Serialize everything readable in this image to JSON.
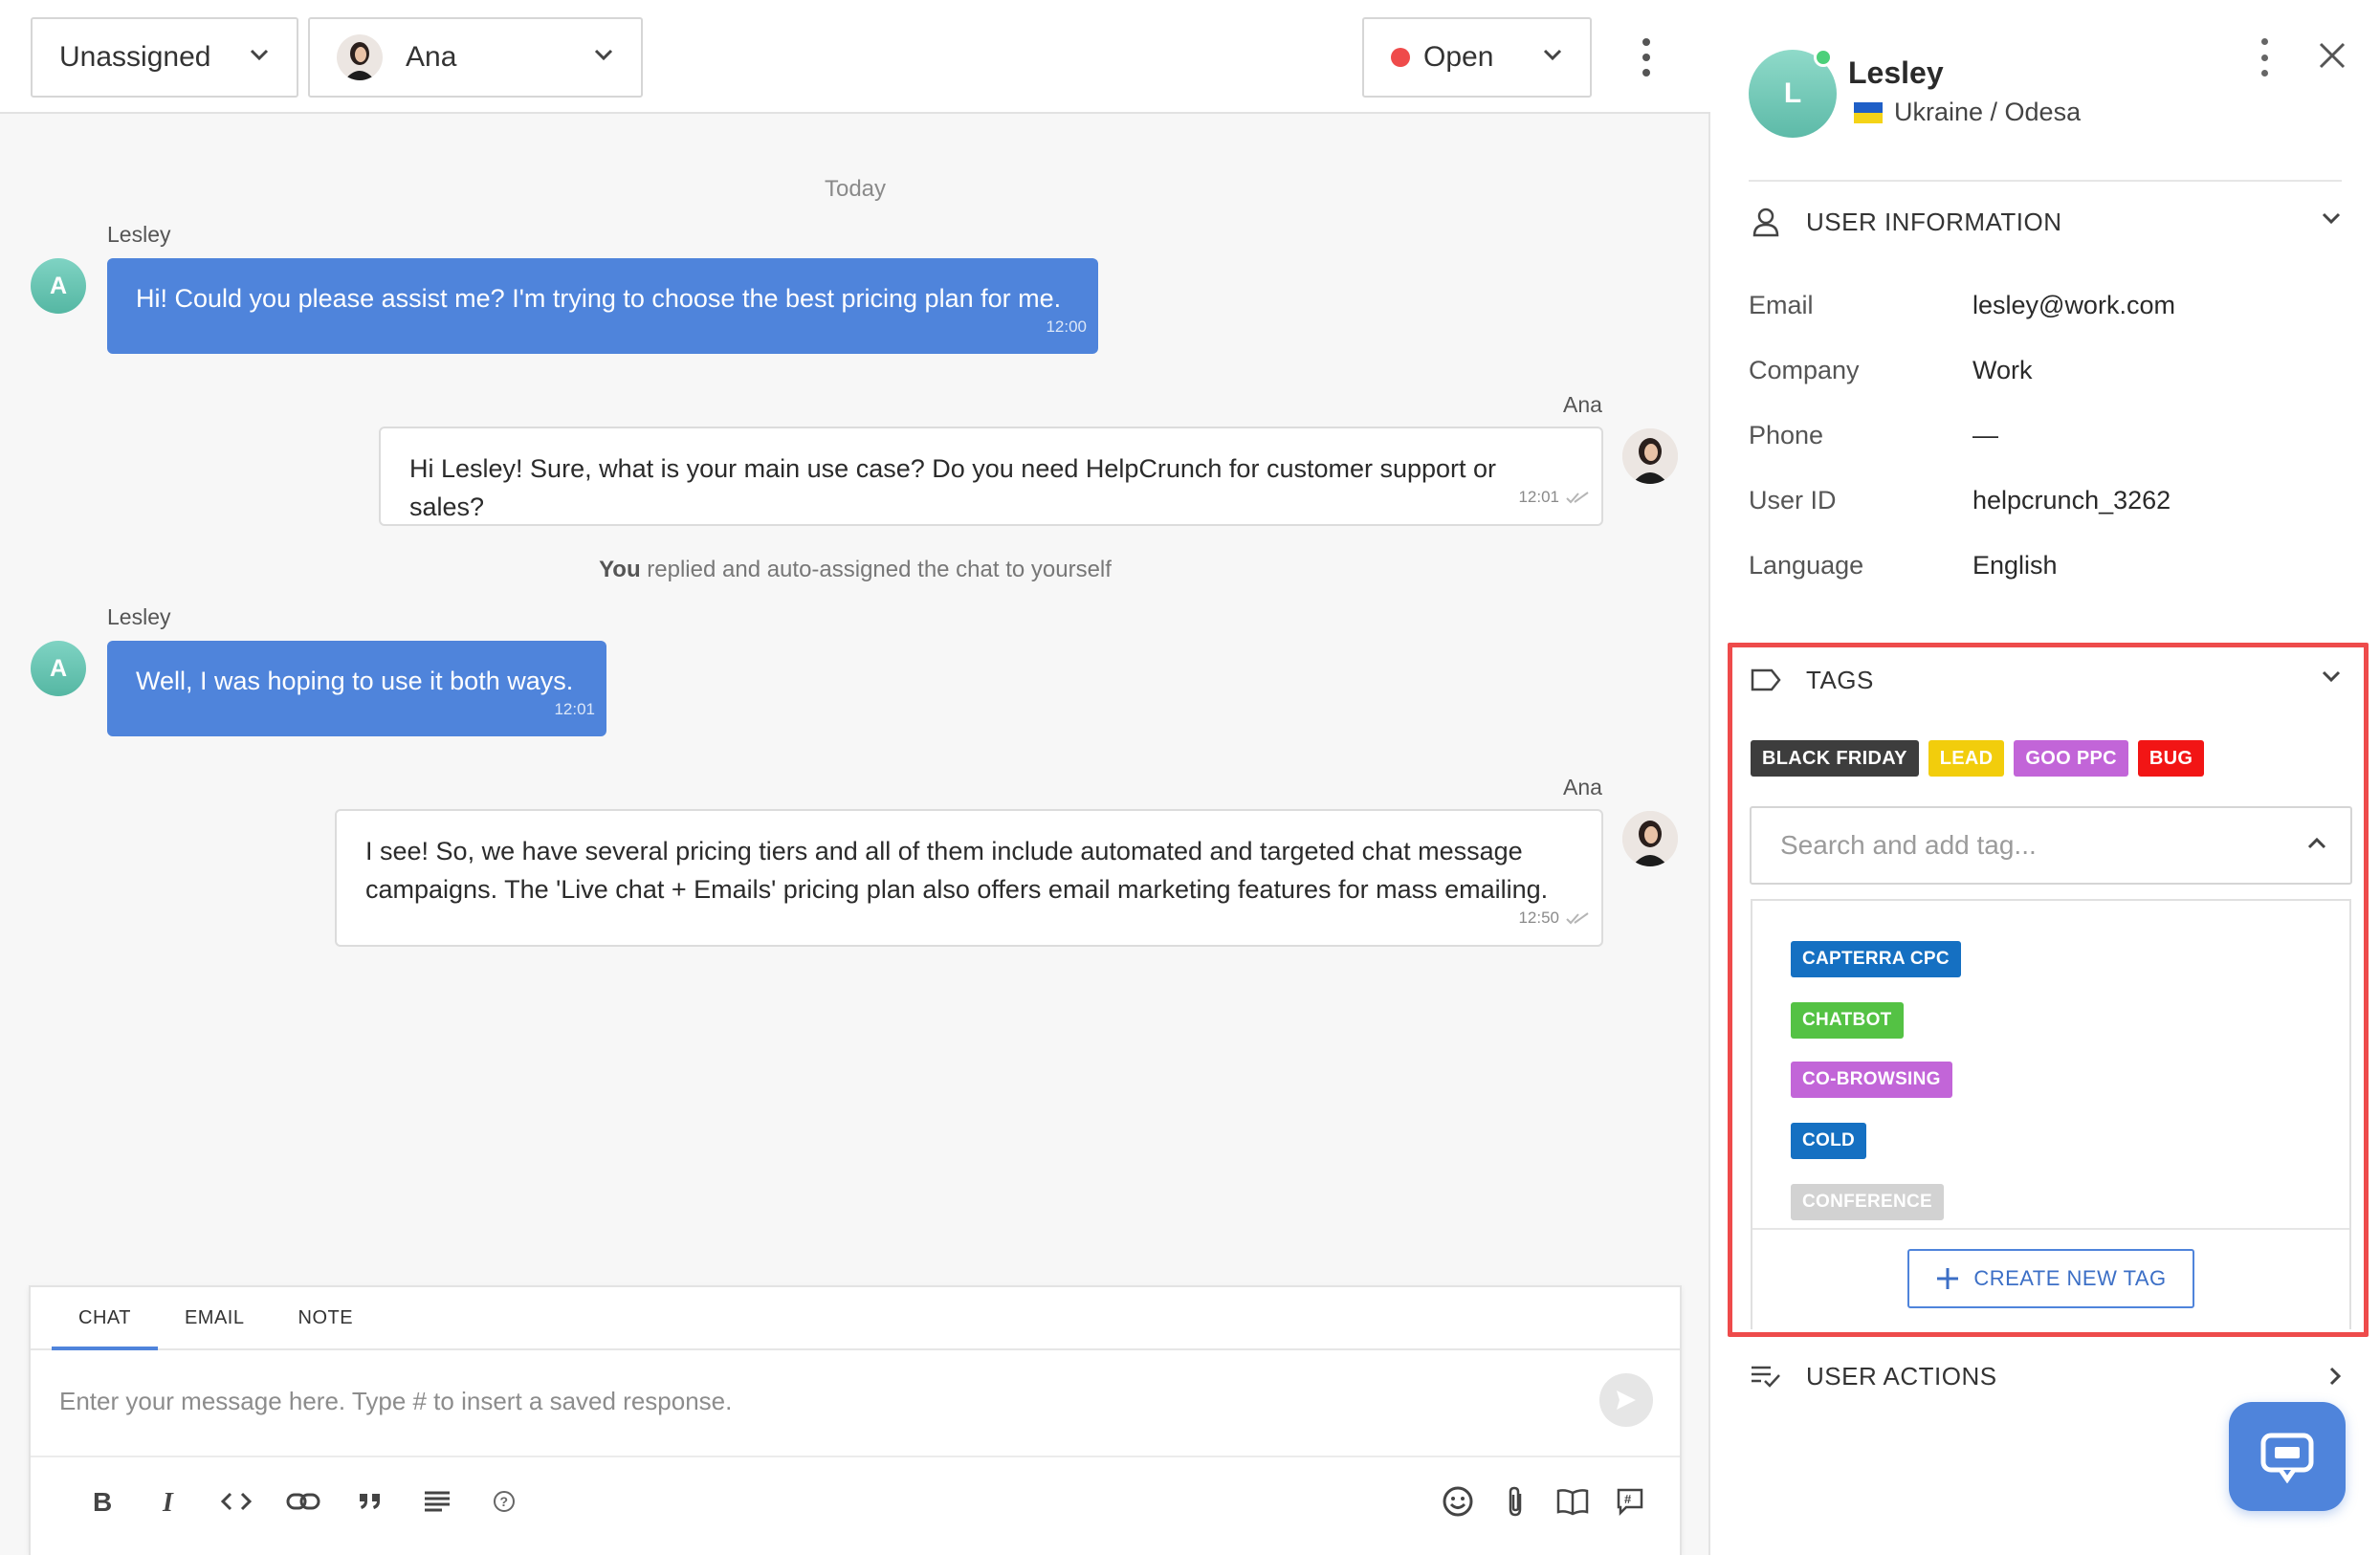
{
  "header": {
    "assignee": "Unassigned",
    "agent": "Ana",
    "status": "Open"
  },
  "chat": {
    "day_separator": "Today",
    "messages": [
      {
        "sender": "Lesley",
        "avatar_letter": "A",
        "text": "Hi! Could you please assist me? I'm trying to choose the best pricing plan for me.",
        "time": "12:00"
      },
      {
        "sender": "Ana",
        "text": "Hi Lesley! Sure, what is your main use case? Do you need HelpCrunch for customer support or sales?",
        "time": "12:01"
      },
      {
        "sender": "Lesley",
        "avatar_letter": "A",
        "text": "Well, I was hoping to use it both ways.",
        "time": "12:01"
      },
      {
        "sender": "Ana",
        "text_line1": "I see! So, we have several pricing tiers and all of them include automated and targeted chat message",
        "text_line2": "campaigns. The 'Live chat + Emails' pricing plan also offers email marketing features for mass emailing.",
        "time": "12:50"
      }
    ],
    "system_note_actor": "You",
    "system_note_text": " replied and auto-assigned the chat to yourself"
  },
  "composer": {
    "tabs": [
      "CHAT",
      "EMAIL",
      "NOTE"
    ],
    "active_tab": "CHAT",
    "placeholder": "Enter your message here. Type # to insert a saved response."
  },
  "profile": {
    "avatar_letter": "L",
    "name": "Lesley",
    "location": "Ukraine / Odesa"
  },
  "user_information": {
    "title": "USER INFORMATION",
    "rows": [
      {
        "label": "Email",
        "value": "lesley@work.com"
      },
      {
        "label": "Company",
        "value": "Work"
      },
      {
        "label": "Phone",
        "value": "—"
      },
      {
        "label": "User ID",
        "value": "helpcrunch_3262"
      },
      {
        "label": "Language",
        "value": "English"
      }
    ]
  },
  "tags": {
    "title": "TAGS",
    "applied": [
      {
        "label": "BLACK FRIDAY",
        "color": "#3d3d3d"
      },
      {
        "label": "LEAD",
        "color": "#f2cd0c"
      },
      {
        "label": "GOO PPC",
        "color": "#c265d8"
      },
      {
        "label": "BUG",
        "color": "#f21515"
      }
    ],
    "search_placeholder": "Search and add tag...",
    "options": [
      {
        "label": "CAPTERRA CPC",
        "color": "#1570c2"
      },
      {
        "label": "CHATBOT",
        "color": "#54c244"
      },
      {
        "label": "CO-BROWSING",
        "color": "#c265d8"
      },
      {
        "label": "COLD",
        "color": "#1570c2"
      },
      {
        "label": "CONFERENCE",
        "color": "#d2d2d2"
      }
    ],
    "create_label": "CREATE NEW TAG"
  },
  "user_actions": {
    "title": "USER ACTIONS"
  },
  "colors": {
    "accent": "#4f84db",
    "highlight_border": "#ee4b4b",
    "status_open": "#ef4b4b",
    "online": "#4cd07a"
  }
}
